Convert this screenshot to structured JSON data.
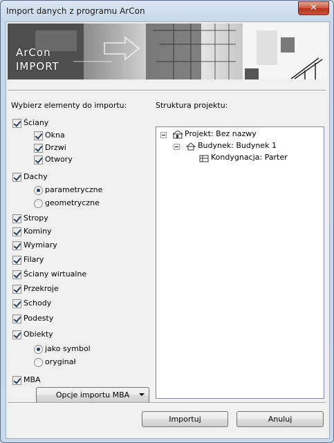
{
  "window": {
    "title": "Import danych z programu ArCon",
    "close_glyph": "✕"
  },
  "banner": {
    "logo_line1": "ArCon",
    "logo_line2": "IMPORT"
  },
  "left": {
    "heading": "Wybierz elementy do importu:",
    "sciany": "Ściany",
    "okna": "Okna",
    "drzwi": "Drzwi",
    "otwory": "Otwory",
    "dachy": "Dachy",
    "parametryczne": "parametryczne",
    "geometryczne": "geometryczne",
    "stropy": "Stropy",
    "kominy": "Kominy",
    "wymiary": "Wymiary",
    "filary": "Filary",
    "sciany_wirtualne": "Ściany wirtualne",
    "przekroje": "Przekroje",
    "schody": "Schody",
    "podesty": "Podesty",
    "obiekty": "Obiekty",
    "jako_symbol": "jako symbol",
    "oryginal": "oryginał",
    "mba": "MBA",
    "mba_button": "Opcje importu MBA"
  },
  "right": {
    "heading": "Struktura projektu:",
    "tree": {
      "project": "Projekt: Bez nazwy",
      "building": "Budynek: Budynek 1",
      "floor": "Kondygnacja: Parter"
    }
  },
  "buttons": {
    "import": "Importuj",
    "cancel": "Anuluj"
  },
  "state": {
    "checked": [
      "Ściany",
      "Okna",
      "Drzwi",
      "Otwory",
      "Dachy",
      "Stropy",
      "Kominy",
      "Wymiary",
      "Filary",
      "Ściany wirtualne",
      "Przekroje",
      "Schody",
      "Podesty",
      "Obiekty",
      "MBA"
    ],
    "dachy_mode": "parametryczne",
    "obiekty_mode": "jako symbol"
  }
}
